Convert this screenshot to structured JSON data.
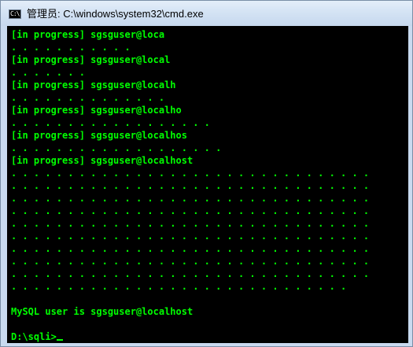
{
  "window": {
    "title": "管理员: C:\\windows\\system32\\cmd.exe",
    "icon": "console-icon",
    "icon_glyph": "C:\\"
  },
  "console": {
    "text_color": "#00ff00",
    "background_color": "#000000",
    "lines": [
      "[in progress] sgsguser@loca",
      ". . . . . . . . . . .",
      "[in progress] sgsguser@local",
      ". . . . . . .",
      "[in progress] sgsguser@localh",
      ". . . . . . . . . . . . . .",
      "[in progress] sgsguser@localho",
      ". . . . . . . . . . . . . . . . . .",
      "[in progress] sgsguser@localhos",
      ". . . . . . . . . . . . . . . . . . .",
      "[in progress] sgsguser@localhost",
      ". . . . . . . . . . . . . . . . . . . . . . . . . . . . . . . .",
      ". . . . . . . . . . . . . . . . . . . . . . . . . . . . . . . .",
      ". . . . . . . . . . . . . . . . . . . . . . . . . . . . . . . .",
      ". . . . . . . . . . . . . . . . . . . . . . . . . . . . . . . .",
      ". . . . . . . . . . . . . . . . . . . . . . . . . . . . . . . .",
      ". . . . . . . . . . . . . . . . . . . . . . . . . . . . . . . .",
      ". . . . . . . . . . . . . . . . . . . . . . . . . . . . . . . .",
      ". . . . . . . . . . . . . . . . . . . . . . . . . . . . . . . .",
      ". . . . . . . . . . . . . . . . . . . . . . . . . . . . . . . .",
      ". . . . . . . . . . . . . . . . . . . . . . . . . . . . . .",
      "MySQL user is sgsguser@localhost",
      ""
    ],
    "prompt": "D:\\sqli>"
  }
}
